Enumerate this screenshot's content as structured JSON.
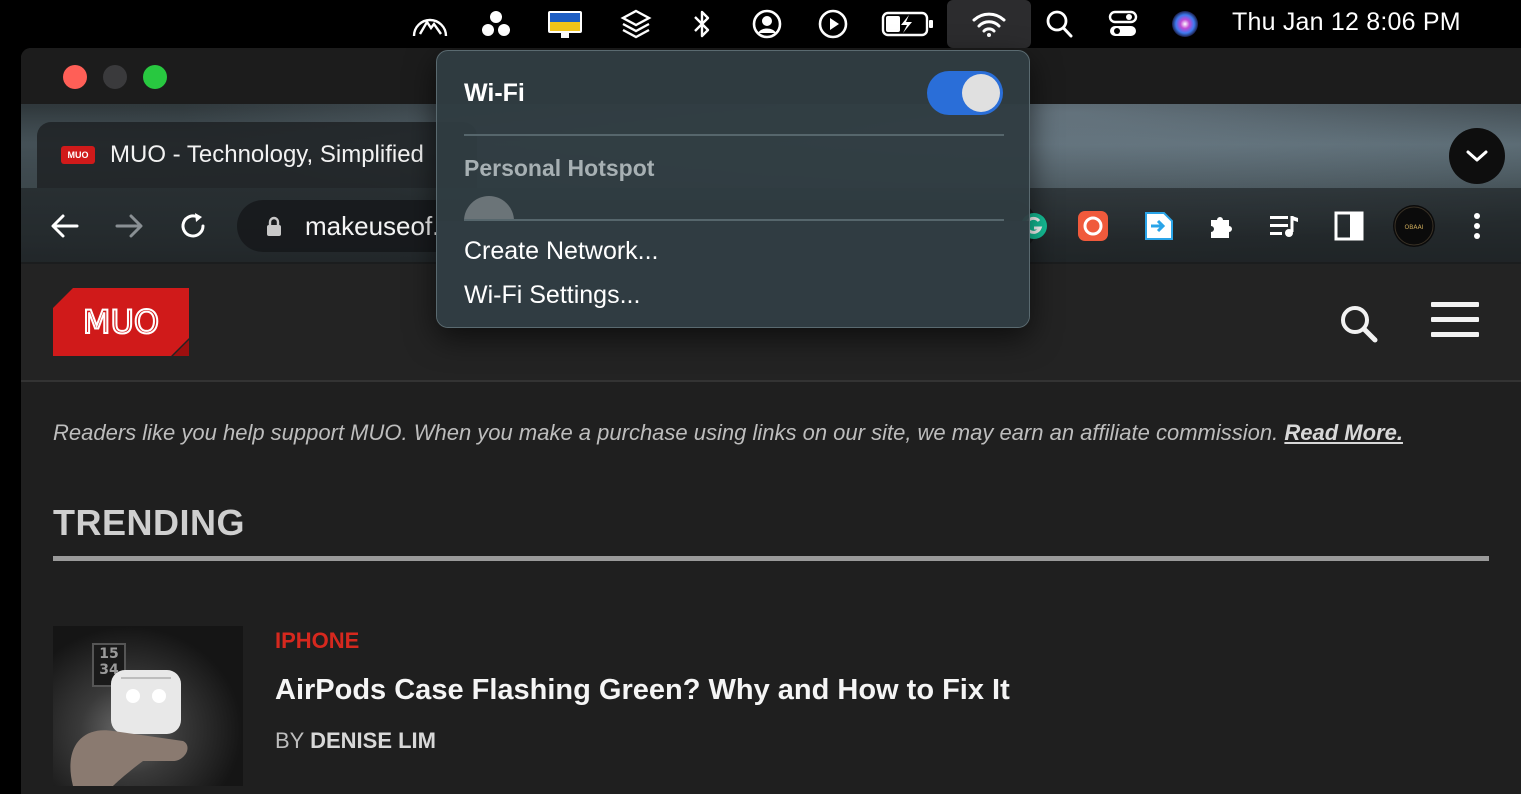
{
  "menubar": {
    "clock": "Thu Jan 12  8:06 PM",
    "icons": [
      "mountain-icon",
      "dots-cluster-icon",
      "ukraine-flag-monitor-icon",
      "layers-icon",
      "bluetooth-icon",
      "user-circle-icon",
      "play-circle-icon",
      "battery-charging-icon",
      "wifi-icon",
      "spotlight-search-icon",
      "control-center-icon",
      "siri-icon"
    ]
  },
  "browser": {
    "tab": {
      "favicon": "MUO",
      "title": "MUO - Technology, Simplified"
    },
    "address": "makeuseof.com",
    "extensions": [
      "grammarly-icon",
      "screen-recorder-icon",
      "share-arrow-icon",
      "extensions-puzzle-icon",
      "playlist-icon",
      "side-panel-icon",
      "profile-avatar-icon",
      "more-menu-icon"
    ]
  },
  "site": {
    "logo_text": "MUO",
    "disclaimer": "Readers like you help support MUO. When you make a purchase using links on our site, we may earn an affiliate commission.",
    "disclaimer_link": "Read More.",
    "section_title": "TRENDING",
    "article": {
      "category": "IPHONE",
      "title": "AirPods Case Flashing Green? Why and How to Fix It",
      "by_label": "BY",
      "author": "DENISE LIM"
    }
  },
  "wifi_menu": {
    "title": "Wi-Fi",
    "toggle_on": true,
    "section": "Personal Hotspot",
    "items": [
      "Create Network...",
      "Wi-Fi Settings..."
    ]
  },
  "colors": {
    "accent_blue": "#2a6ed8",
    "muo_red": "#d01a1a",
    "category_red": "#d6281e"
  }
}
